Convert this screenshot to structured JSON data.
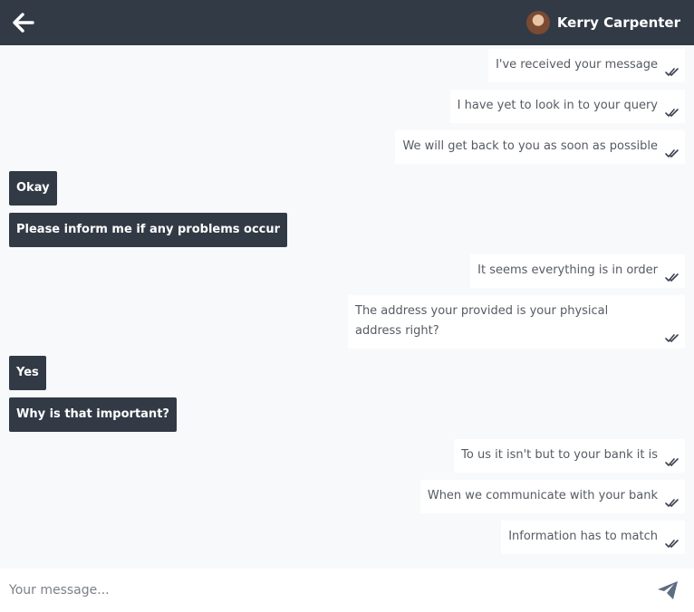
{
  "header": {
    "contact_name": "Kerry Carpenter",
    "back_icon": "arrow-left-icon"
  },
  "messages": [
    {
      "from": "sent",
      "text": "I've received your message"
    },
    {
      "from": "sent",
      "text": "I have yet to look in to your query"
    },
    {
      "from": "sent",
      "text": "We will get back to you as soon as possible"
    },
    {
      "from": "received",
      "text": "Okay"
    },
    {
      "from": "received",
      "text": "Please inform me if any problems occur"
    },
    {
      "from": "sent",
      "text": "It seems everything is in order"
    },
    {
      "from": "sent",
      "text": "The address your provided is your physical address right?"
    },
    {
      "from": "received",
      "text": "Yes"
    },
    {
      "from": "received",
      "text": "Why is that important?"
    },
    {
      "from": "sent",
      "text": "To us it isn't but to your bank it is"
    },
    {
      "from": "sent",
      "text": "When we communicate with your bank"
    },
    {
      "from": "sent",
      "text": "Information has to match"
    }
  ],
  "composer": {
    "placeholder": "Your message...",
    "send_icon": "paper-plane-icon"
  },
  "colors": {
    "header_bg": "#323a45",
    "received_bubble": "#323a45",
    "sent_bubble": "#ffffff",
    "background": "#f8f9fb"
  }
}
